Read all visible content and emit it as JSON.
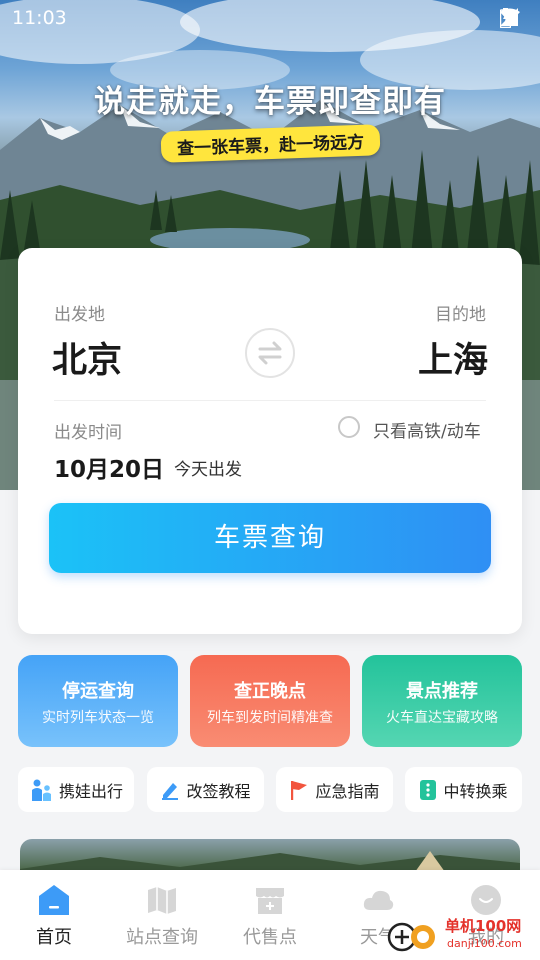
{
  "status_bar": {
    "time": "11:03"
  },
  "hero": {
    "headline": "说走就走，车票即查即有",
    "subline": "查一张车票，赴一场远方"
  },
  "search": {
    "from_label": "出发地",
    "from_city": "北京",
    "to_label": "目的地",
    "to_city": "上海",
    "date_label": "出发时间",
    "date": "10月20日",
    "date_hint": "今天出发",
    "high_speed_only_label": "只看高铁/动车",
    "high_speed_only_checked": false,
    "query_button": "车票查询"
  },
  "features": [
    {
      "title": "停运查询",
      "subtitle": "实时列车状态一览"
    },
    {
      "title": "查正晚点",
      "subtitle": "列车到发时间精准查"
    },
    {
      "title": "景点推荐",
      "subtitle": "火车直达宝藏攻略"
    }
  ],
  "chips": [
    {
      "label": "携娃出行",
      "icon": "family-icon"
    },
    {
      "label": "改签教程",
      "icon": "pencil-icon"
    },
    {
      "label": "应急指南",
      "icon": "flag-icon"
    },
    {
      "label": "中转换乘",
      "icon": "transfer-icon"
    }
  ],
  "tabs": [
    {
      "label": "首页",
      "icon": "home-icon",
      "active": true
    },
    {
      "label": "站点查询",
      "icon": "map-icon",
      "active": false
    },
    {
      "label": "代售点",
      "icon": "shop-icon",
      "active": false
    },
    {
      "label": "天气",
      "icon": "cloud-icon",
      "active": false
    },
    {
      "label": "我的",
      "icon": "profile-icon",
      "active": false
    }
  ],
  "watermark": {
    "site": "单机100网",
    "url": "danji100.com"
  },
  "colors": {
    "primary_gradient_start": "#1bc2f7",
    "primary_gradient_end": "#2f8ff4",
    "tile_blue": "#45a3f7",
    "tile_red": "#f66a52",
    "tile_green": "#23c39b",
    "tab_active": "#3d9bf7",
    "subline_bg": "#ffe53d"
  }
}
